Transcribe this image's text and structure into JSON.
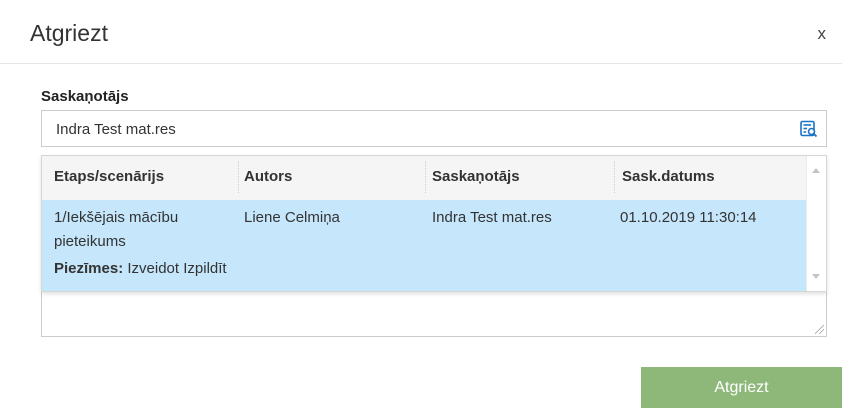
{
  "dialog": {
    "title": "Atgriezt",
    "close_label": "x",
    "approver_label": "Saskaņotājs",
    "approver_value": "Indra Test mat.res",
    "lookup_icon": "search-list-icon",
    "accent_color": "#1a73c7",
    "submit_label": "Atgriezt",
    "submit_color": "#8db87a"
  },
  "grid": {
    "columns": [
      "Etaps/scenārijs",
      "Autors",
      "Saskaņotājs",
      "Sask.datums"
    ],
    "rows": [
      {
        "stage_line1": "1/Iekšējais mācību",
        "stage_line2": "pieteikums",
        "author": "Liene Celmiņa",
        "approver": "Indra Test mat.res",
        "date": "01.10.2019 11:30:14",
        "notes_label": "Piezīmes:",
        "notes_value": "Izveidot Izpildīt"
      }
    ],
    "selected_row_color": "#c5e6fb"
  }
}
